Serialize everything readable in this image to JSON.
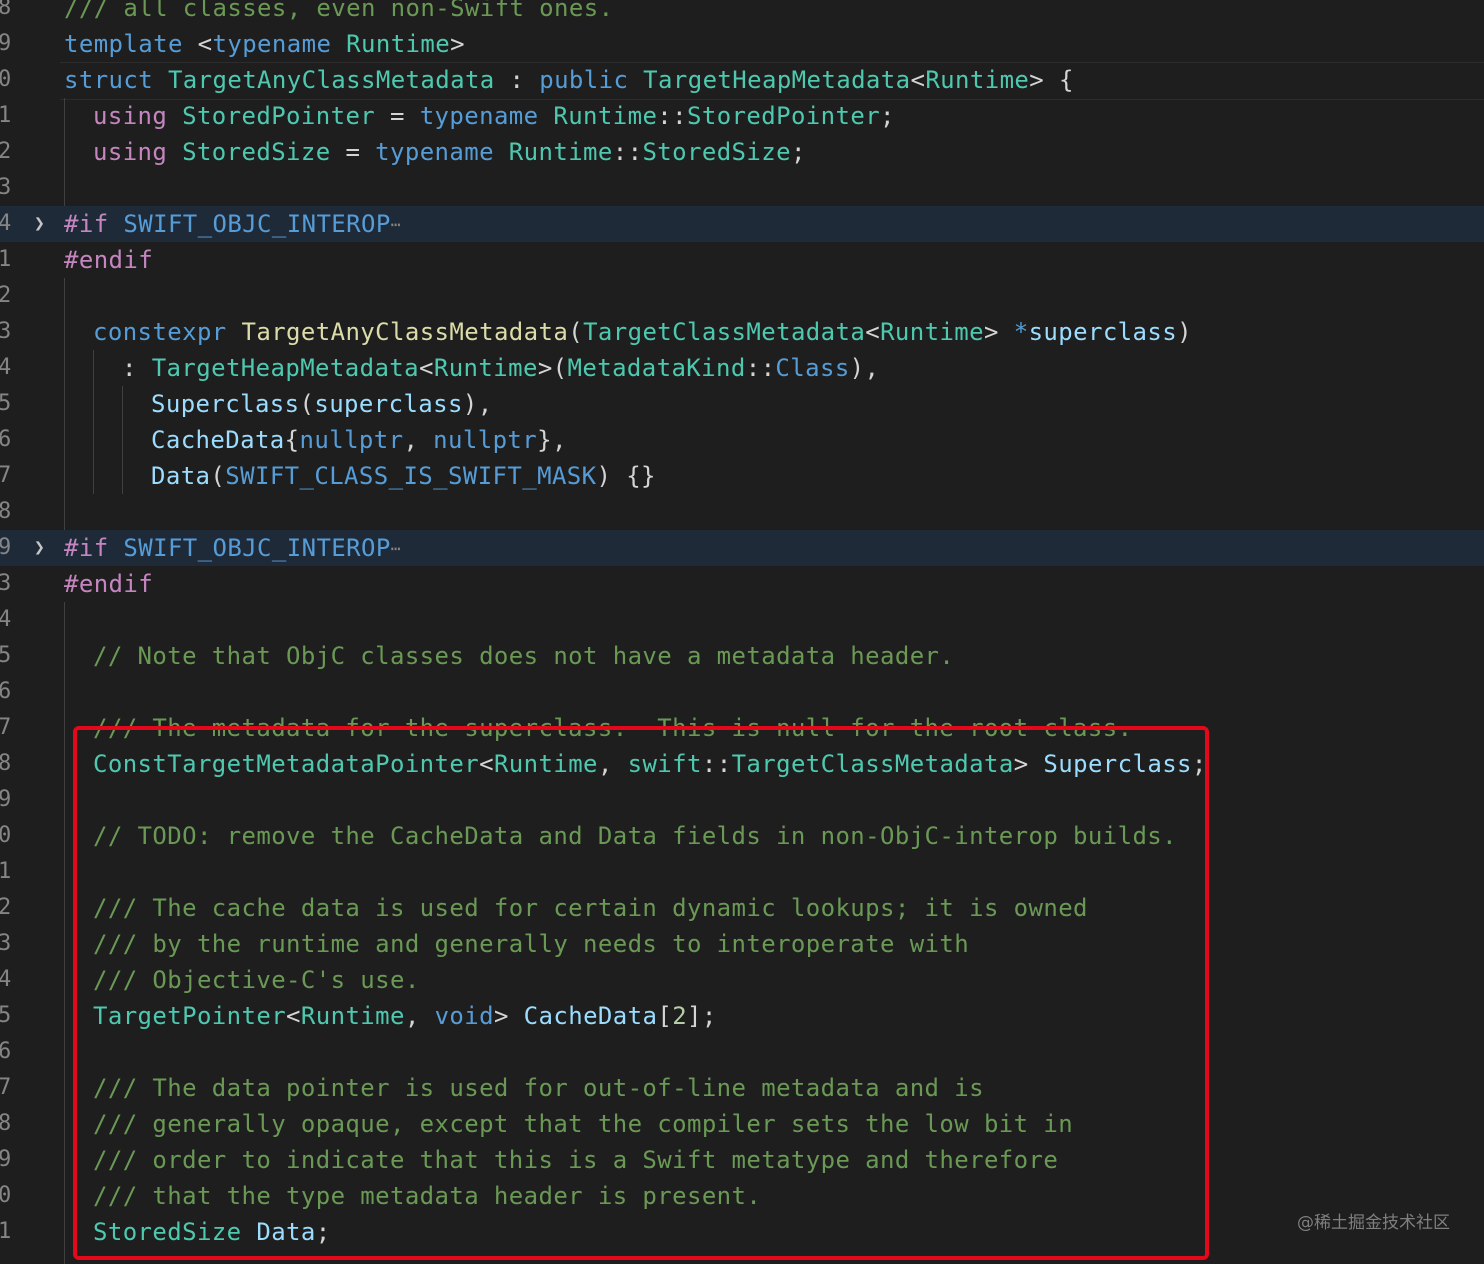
{
  "colors": {
    "background": "#1e1e1e",
    "keyword": "#569cd6",
    "keyword_control": "#c586c0",
    "type": "#4ec9b0",
    "function": "#dcdcaa",
    "variable": "#9cdcfe",
    "comment": "#6a9955",
    "number": "#b5cea8",
    "text": "#d4d4d4",
    "highlight_box": "#e3091b"
  },
  "editor": {
    "lines": [
      {
        "n": "8",
        "indent": 0,
        "tokens": [
          {
            "t": "/// all classes, even non-Swift ones.",
            "c": "comment"
          }
        ]
      },
      {
        "n": "9",
        "indent": 0,
        "tokens": [
          {
            "t": "template",
            "c": "keyword"
          },
          {
            "t": " <",
            "c": "text"
          },
          {
            "t": "typename",
            "c": "keyword"
          },
          {
            "t": " Runtime",
            "c": "type"
          },
          {
            "t": ">",
            "c": "text"
          }
        ]
      },
      {
        "n": "0",
        "indent": 0,
        "tokens": [
          {
            "t": "struct",
            "c": "keyword"
          },
          {
            "t": " TargetAnyClassMetadata",
            "c": "type"
          },
          {
            "t": " : ",
            "c": "text"
          },
          {
            "t": "public",
            "c": "keyword"
          },
          {
            "t": " TargetHeapMetadata",
            "c": "type"
          },
          {
            "t": "<",
            "c": "text"
          },
          {
            "t": "Runtime",
            "c": "type"
          },
          {
            "t": "> ",
            "c": "text"
          },
          {
            "t": "{",
            "c": "text"
          }
        ]
      },
      {
        "n": "1",
        "indent": 1,
        "tokens": [
          {
            "t": "using",
            "c": "keyword_control"
          },
          {
            "t": " StoredPointer",
            "c": "type"
          },
          {
            "t": " = ",
            "c": "text"
          },
          {
            "t": "typename",
            "c": "keyword"
          },
          {
            "t": " Runtime",
            "c": "type"
          },
          {
            "t": "::",
            "c": "text"
          },
          {
            "t": "StoredPointer",
            "c": "type"
          },
          {
            "t": ";",
            "c": "text"
          }
        ]
      },
      {
        "n": "2",
        "indent": 1,
        "tokens": [
          {
            "t": "using",
            "c": "keyword_control"
          },
          {
            "t": " StoredSize",
            "c": "type"
          },
          {
            "t": " = ",
            "c": "text"
          },
          {
            "t": "typename",
            "c": "keyword"
          },
          {
            "t": " Runtime",
            "c": "type"
          },
          {
            "t": "::",
            "c": "text"
          },
          {
            "t": "StoredSize",
            "c": "type"
          },
          {
            "t": ";",
            "c": "text"
          }
        ]
      },
      {
        "n": "3",
        "indent": 0,
        "tokens": []
      },
      {
        "n": "4",
        "indent": 0,
        "fold": true,
        "tokens": [
          {
            "t": "#if",
            "c": "keyword_control"
          },
          {
            "t": " SWIFT_OBJC_INTEROP",
            "c": "keyword"
          }
        ]
      },
      {
        "n": "1",
        "indent": 0,
        "tokens": [
          {
            "t": "#endif",
            "c": "keyword_control"
          }
        ]
      },
      {
        "n": "2",
        "indent": 0,
        "tokens": []
      },
      {
        "n": "3",
        "indent": 1,
        "tokens": [
          {
            "t": "constexpr",
            "c": "keyword"
          },
          {
            "t": " TargetAnyClassMetadata",
            "c": "function"
          },
          {
            "t": "(",
            "c": "text"
          },
          {
            "t": "TargetClassMetadata",
            "c": "type"
          },
          {
            "t": "<",
            "c": "text"
          },
          {
            "t": "Runtime",
            "c": "type"
          },
          {
            "t": "> ",
            "c": "text"
          },
          {
            "t": "*",
            "c": "keyword"
          },
          {
            "t": "superclass",
            "c": "variable"
          },
          {
            "t": ")",
            "c": "text"
          }
        ]
      },
      {
        "n": "4",
        "indent": 2,
        "tokens": [
          {
            "t": ": ",
            "c": "text"
          },
          {
            "t": "TargetHeapMetadata",
            "c": "type"
          },
          {
            "t": "<",
            "c": "text"
          },
          {
            "t": "Runtime",
            "c": "type"
          },
          {
            "t": ">(",
            "c": "text"
          },
          {
            "t": "MetadataKind",
            "c": "type"
          },
          {
            "t": "::",
            "c": "text"
          },
          {
            "t": "Class",
            "c": "keyword"
          },
          {
            "t": "),",
            "c": "text"
          }
        ]
      },
      {
        "n": "5",
        "indent": 3,
        "tokens": [
          {
            "t": "Superclass",
            "c": "variable"
          },
          {
            "t": "(",
            "c": "text"
          },
          {
            "t": "superclass",
            "c": "variable"
          },
          {
            "t": "),",
            "c": "text"
          }
        ]
      },
      {
        "n": "6",
        "indent": 3,
        "tokens": [
          {
            "t": "CacheData",
            "c": "variable"
          },
          {
            "t": "{",
            "c": "text"
          },
          {
            "t": "nullptr",
            "c": "keyword"
          },
          {
            "t": ", ",
            "c": "text"
          },
          {
            "t": "nullptr",
            "c": "keyword"
          },
          {
            "t": "},",
            "c": "text"
          }
        ]
      },
      {
        "n": "7",
        "indent": 3,
        "tokens": [
          {
            "t": "Data",
            "c": "variable"
          },
          {
            "t": "(",
            "c": "text"
          },
          {
            "t": "SWIFT_CLASS_IS_SWIFT_MASK",
            "c": "keyword"
          },
          {
            "t": ") {}",
            "c": "text"
          }
        ]
      },
      {
        "n": "8",
        "indent": 0,
        "tokens": []
      },
      {
        "n": "9",
        "indent": 0,
        "fold": true,
        "tokens": [
          {
            "t": "#if",
            "c": "keyword_control"
          },
          {
            "t": " SWIFT_OBJC_INTEROP",
            "c": "keyword"
          }
        ]
      },
      {
        "n": "3",
        "indent": 0,
        "tokens": [
          {
            "t": "#endif",
            "c": "keyword_control"
          }
        ]
      },
      {
        "n": "4",
        "indent": 0,
        "tokens": []
      },
      {
        "n": "5",
        "indent": 1,
        "tokens": [
          {
            "t": "// Note that ObjC classes does not have a metadata header.",
            "c": "comment"
          }
        ]
      },
      {
        "n": "6",
        "indent": 0,
        "tokens": []
      },
      {
        "n": "7",
        "indent": 1,
        "strike": true,
        "tokens": [
          {
            "t": "/// The metadata for the superclass.  This is null for the root class.",
            "c": "comment"
          }
        ]
      },
      {
        "n": "8",
        "indent": 1,
        "tokens": [
          {
            "t": "ConstTargetMetadataPointer",
            "c": "type"
          },
          {
            "t": "<",
            "c": "text"
          },
          {
            "t": "Runtime",
            "c": "type"
          },
          {
            "t": ", ",
            "c": "text"
          },
          {
            "t": "swift",
            "c": "type"
          },
          {
            "t": "::",
            "c": "text"
          },
          {
            "t": "TargetClassMetadata",
            "c": "type"
          },
          {
            "t": "> ",
            "c": "text"
          },
          {
            "t": "Superclass",
            "c": "variable"
          },
          {
            "t": ";",
            "c": "text"
          }
        ]
      },
      {
        "n": "9",
        "indent": 0,
        "tokens": []
      },
      {
        "n": "0",
        "indent": 1,
        "tokens": [
          {
            "t": "// TODO: remove the CacheData and Data fields in non-ObjC-interop builds.",
            "c": "comment"
          }
        ]
      },
      {
        "n": "1",
        "indent": 0,
        "tokens": []
      },
      {
        "n": "2",
        "indent": 1,
        "tokens": [
          {
            "t": "/// The cache data is used for certain dynamic lookups; it is owned",
            "c": "comment"
          }
        ]
      },
      {
        "n": "3",
        "indent": 1,
        "tokens": [
          {
            "t": "/// by the runtime and generally needs to interoperate with",
            "c": "comment"
          }
        ]
      },
      {
        "n": "4",
        "indent": 1,
        "tokens": [
          {
            "t": "/// Objective-C's use.",
            "c": "comment"
          }
        ]
      },
      {
        "n": "5",
        "indent": 1,
        "tokens": [
          {
            "t": "TargetPointer",
            "c": "type"
          },
          {
            "t": "<",
            "c": "text"
          },
          {
            "t": "Runtime",
            "c": "type"
          },
          {
            "t": ", ",
            "c": "text"
          },
          {
            "t": "void",
            "c": "keyword"
          },
          {
            "t": "> ",
            "c": "text"
          },
          {
            "t": "CacheData",
            "c": "variable"
          },
          {
            "t": "[",
            "c": "text"
          },
          {
            "t": "2",
            "c": "number"
          },
          {
            "t": "];",
            "c": "text"
          }
        ]
      },
      {
        "n": "6",
        "indent": 0,
        "tokens": []
      },
      {
        "n": "7",
        "indent": 1,
        "tokens": [
          {
            "t": "/// The data pointer is used for out-of-line metadata and is",
            "c": "comment"
          }
        ]
      },
      {
        "n": "8",
        "indent": 1,
        "tokens": [
          {
            "t": "/// generally opaque, except that the compiler sets the low bit in",
            "c": "comment"
          }
        ]
      },
      {
        "n": "9",
        "indent": 1,
        "tokens": [
          {
            "t": "/// order to indicate that this is a Swift metatype and therefore",
            "c": "comment"
          }
        ]
      },
      {
        "n": "0",
        "indent": 1,
        "tokens": [
          {
            "t": "/// that the type metadata header is present.",
            "c": "comment"
          }
        ]
      },
      {
        "n": "1",
        "indent": 1,
        "tokens": [
          {
            "t": "StoredSize",
            "c": "type"
          },
          {
            "t": " Data",
            "c": "variable"
          },
          {
            "t": ";",
            "c": "text"
          }
        ]
      }
    ]
  },
  "watermark": "@稀土掘金技术社区"
}
